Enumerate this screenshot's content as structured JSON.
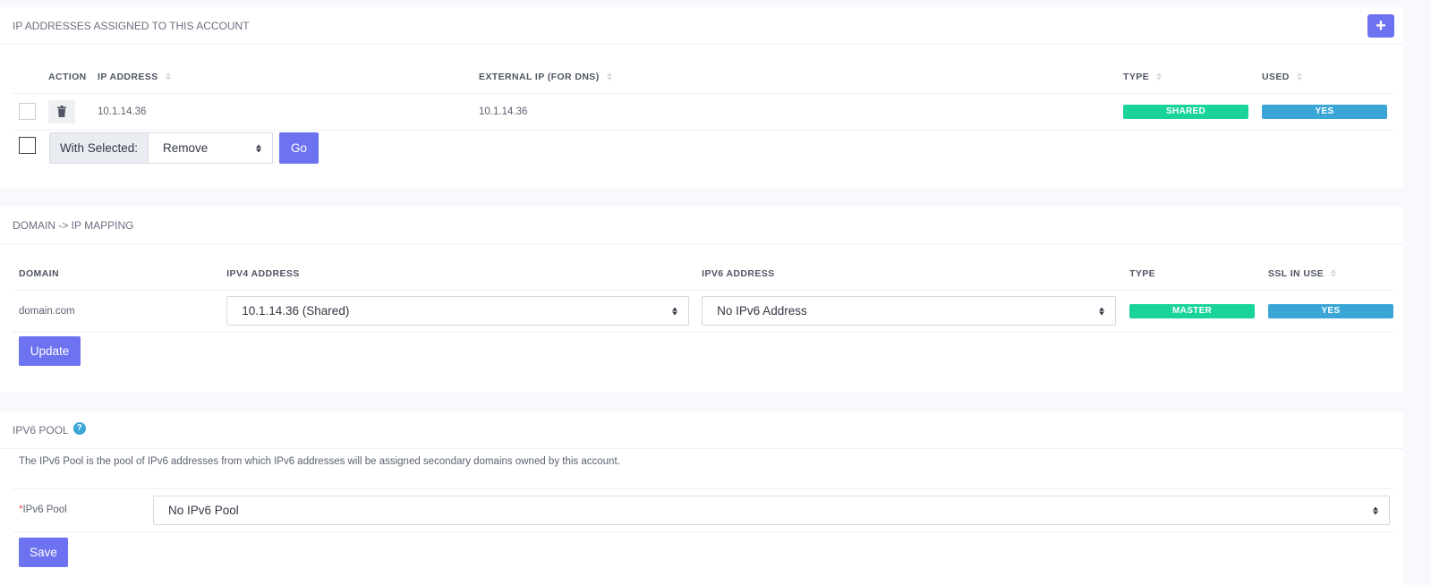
{
  "colors": {
    "accent": "#6c72f0",
    "shared_badge": "#19d39a",
    "master_badge": "#19d39a",
    "yes_badge": "#3aa6d6",
    "required": "#e14b4b"
  },
  "ip_section": {
    "title": "IP ADDRESSES ASSIGNED TO THIS ACCOUNT",
    "add_icon": "plus-icon",
    "columns": {
      "action": "ACTION",
      "ip_address": "IP ADDRESS",
      "external_ip": "EXTERNAL IP (FOR DNS)",
      "type": "TYPE",
      "used": "USED"
    },
    "rows": [
      {
        "delete_icon": "trash-icon",
        "ip_address": "10.1.14.36",
        "external_ip": "10.1.14.36",
        "type": "SHARED",
        "used": "YES"
      }
    ],
    "with_selected_label": "With Selected:",
    "bulk_action_value": "Remove",
    "go_label": "Go"
  },
  "mapping_section": {
    "title": "DOMAIN -> IP MAPPING",
    "columns": {
      "domain": "DOMAIN",
      "ipv4": "IPV4 ADDRESS",
      "ipv6": "IPV6 ADDRESS",
      "type": "TYPE",
      "ssl": "SSL IN USE"
    },
    "rows": [
      {
        "domain": "domain.com",
        "ipv4": "10.1.14.36 (Shared)",
        "ipv6": "No IPv6 Address",
        "type": "MASTER",
        "ssl": "YES"
      }
    ],
    "update_label": "Update"
  },
  "pool_section": {
    "title": "IPV6 POOL",
    "help_icon": "question-icon",
    "description": "The IPv6 Pool is the pool of IPv6 addresses from which IPv6 addresses will be assigned secondary domains owned by this account.",
    "required_mark": "*",
    "field_label": "IPv6 Pool",
    "field_value": "No IPv6 Pool",
    "save_label": "Save"
  }
}
